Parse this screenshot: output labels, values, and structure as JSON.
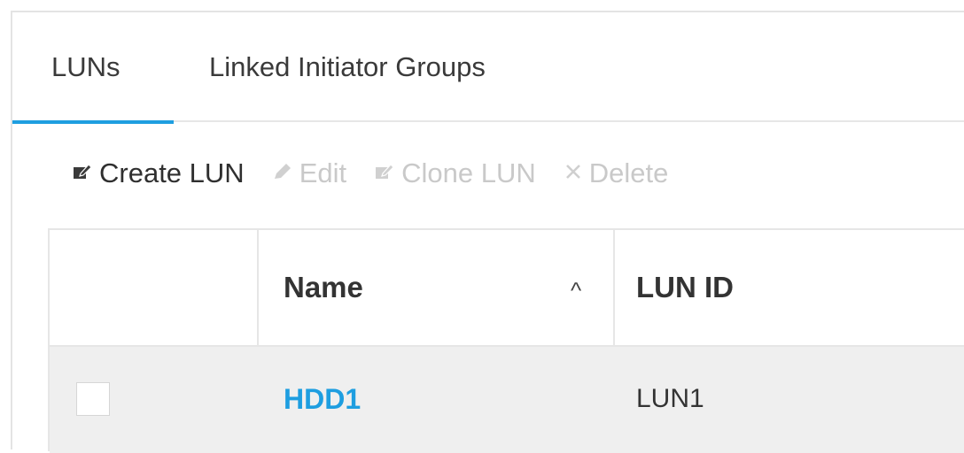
{
  "tabs": [
    {
      "label": "LUNs",
      "active": true
    },
    {
      "label": "Linked Initiator Groups",
      "active": false
    }
  ],
  "colors": {
    "accent": "#1e9ee0",
    "text": "#333333",
    "disabled": "#c9c9c9",
    "row_bg": "#efefef"
  },
  "toolbar": {
    "create": {
      "label": "Create LUN",
      "icon": "edit-square-icon",
      "enabled": true
    },
    "edit": {
      "label": "Edit",
      "icon": "pencil-icon",
      "enabled": false
    },
    "clone": {
      "label": "Clone LUN",
      "icon": "edit-square-icon",
      "enabled": false
    },
    "delete": {
      "label": "Delete",
      "icon": "close-icon",
      "enabled": false
    }
  },
  "table": {
    "columns": [
      {
        "label": ""
      },
      {
        "label": "Name",
        "sort": "ascending"
      },
      {
        "label": "LUN ID"
      }
    ],
    "rows": [
      {
        "name": "HDD1",
        "lun_id": "LUN1",
        "checked": false
      }
    ]
  }
}
